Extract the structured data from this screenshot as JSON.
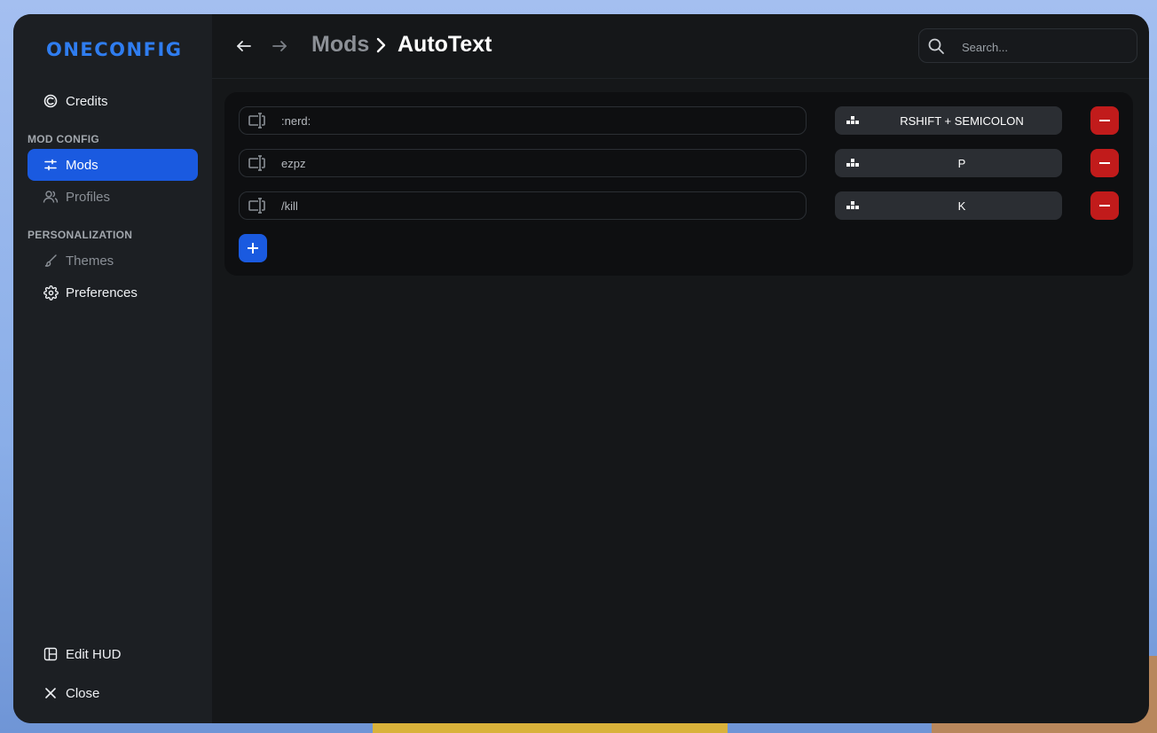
{
  "app": {
    "logo_text": "ONECONFIG"
  },
  "sidebar": {
    "credits_label": "Credits",
    "section_mod_config": "MOD CONFIG",
    "mods_label": "Mods",
    "profiles_label": "Profiles",
    "section_personalization": "PERSONALIZATION",
    "themes_label": "Themes",
    "preferences_label": "Preferences",
    "edit_hud_label": "Edit HUD",
    "close_label": "Close"
  },
  "header": {
    "breadcrumb_parent": "Mods",
    "breadcrumb_current": "AutoText",
    "search_placeholder": "Search..."
  },
  "entries": [
    {
      "text": ":nerd:",
      "keybind": "RSHIFT + SEMICOLON"
    },
    {
      "text": "ezpz",
      "keybind": "P"
    },
    {
      "text": "/kill",
      "keybind": "K"
    }
  ],
  "colors": {
    "accent": "#1a5ae0",
    "danger": "#c11b1b",
    "logo": "#2f7df0"
  }
}
